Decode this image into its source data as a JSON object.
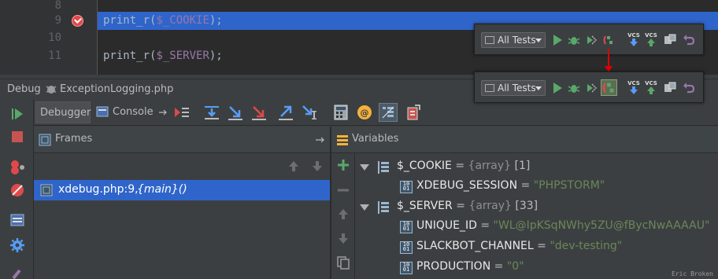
{
  "editor": {
    "lines": [
      {
        "number": "8",
        "code_fn": "",
        "code_var": "",
        "code_end": ""
      },
      {
        "number": "9",
        "code_fn": "print_r(",
        "code_var": "$_COOKIE",
        "code_end": ");"
      },
      {
        "number": "10",
        "code_fn": "",
        "code_var": "",
        "code_end": ""
      },
      {
        "number": "11",
        "code_fn": "print_r(",
        "code_var": "$_SERVER",
        "code_end": ");"
      }
    ],
    "breakpoint_icon": "breakpoint-check-icon"
  },
  "debug": {
    "title_prefix": "Debug",
    "config_name": "ExceptionLogging.php",
    "tabs": [
      {
        "label": "Debugger",
        "active": true
      },
      {
        "label": "Console",
        "active": false
      }
    ],
    "frames": {
      "title": "Frames",
      "items": [
        {
          "file": "xdebug.php:9, ",
          "fn": "{main}()"
        }
      ]
    },
    "variables": {
      "title": "Variables",
      "rows": [
        {
          "name": "$_COOKIE",
          "eq": " = ",
          "type": "{array} ",
          "count": "[1]"
        },
        {
          "name": "XDEBUG_SESSION",
          "eq": " = ",
          "value": "\"PHPSTORM\""
        },
        {
          "name": "$_SERVER",
          "eq": " = ",
          "type": "{array} ",
          "count": "[33]"
        },
        {
          "name": "UNIQUE_ID",
          "eq": " = ",
          "value": "\"WL@IpKSqNWhy5ZU@fBycNwAAAAU\""
        },
        {
          "name": "SLACKBOT_CHANNEL",
          "eq": " = ",
          "value": "\"dev-testing\""
        },
        {
          "name": "PRODUCTION",
          "eq": " = ",
          "value": "\"0\""
        }
      ]
    }
  },
  "vcs_toolbar": {
    "combo_label": "All Tests",
    "vcs_label": "VCS"
  },
  "credit": "Eric Broken",
  "colors": {
    "accent": "#2f65ca",
    "string": "#6a8759",
    "php_var": "#9876aa",
    "run_green": "#59a869",
    "breakpoint_red": "#e0494b",
    "annotation_red": "#e00000"
  }
}
